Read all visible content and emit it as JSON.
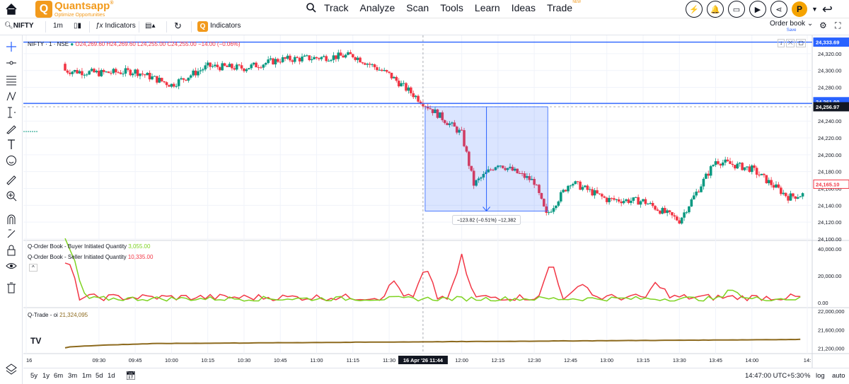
{
  "nav": {
    "brand_name": "Quantsapp",
    "brand_registered": "®",
    "brand_tagline": "Optimize Opportunities",
    "links": [
      "Track",
      "Analyze",
      "Scan",
      "Tools",
      "Learn",
      "Ideas",
      "Trade"
    ],
    "trade_badge": "NEW",
    "avatar_letter": "P"
  },
  "toolbar": {
    "symbol": "NIFTY",
    "interval": "1m",
    "indicators_label": "Indicators",
    "indicators2_label": "Indicators",
    "orderbook_label": "Order book",
    "orderbook_sub": "Save"
  },
  "chart": {
    "main_legend": {
      "symbol": "NIFTY · 1 · NSE",
      "open": "O24,269.60",
      "high": "H24,269.60",
      "low": "L24,255.00",
      "close": "C24,255.00",
      "change": "−14.00 (−0.06%)"
    },
    "price_labels": {
      "top_line": "24,333.69",
      "current": "24,256.97",
      "blue_line": "24,261.00",
      "last": "24,165.10"
    },
    "measure_label": "−123.82 (−0.51%) −12,382",
    "y_ticks": [
      "24,320.00",
      "24,300.00",
      "24,280.00",
      "24,260.00",
      "24,240.00",
      "24,220.00",
      "24,200.00",
      "24,180.00",
      "24,160.00",
      "24,140.00",
      "24,120.00",
      "24,100.00"
    ],
    "indicators": {
      "buyer_label": "Q-Order Book - Buyer Initiated Quantity",
      "buyer_value": "3,055.00",
      "seller_label": "Q-Order Book - Seller Initiated Quantity",
      "seller_value": "10,335.00",
      "ob_ticks": [
        "40,000.00",
        "20,000.00",
        "0.00"
      ],
      "qtrade_label": "Q-Trade - oi",
      "qtrade_value": "21,324,095",
      "qt_ticks": [
        "22,000,000",
        "21,600,000",
        "21,200,000"
      ]
    },
    "x_ticks": [
      "16",
      "09:30",
      "09:45",
      "10:00",
      "10:15",
      "10:30",
      "10:45",
      "11:00",
      "11:15",
      "11:30",
      "12:00",
      "12:15",
      "12:30",
      "12:45",
      "13:00",
      "13:15",
      "13:30",
      "13:45",
      "14:00",
      "14:"
    ],
    "crosshair_date": "16 Apr '26  11:44",
    "colors": {
      "up": "#089981",
      "down": "#f23645",
      "buyer": "#7ed321",
      "seller": "#f23645",
      "qtrade": "#8d6a1e",
      "line": "#2962ff"
    }
  },
  "bottom": {
    "ranges": [
      "5y",
      "1y",
      "6m",
      "3m",
      "1m",
      "5d",
      "1d"
    ],
    "clock": "14:47:00 UTC+5:30",
    "percent_label": "%",
    "log_label": "log",
    "auto_label": "auto"
  },
  "chart_data": {
    "type": "candlestick",
    "xlabel": "",
    "ylabel": "",
    "ylim": [
      24100,
      24335
    ],
    "x_range": [
      "09:15",
      "14:47"
    ],
    "series_points": [
      {
        "time": "09:16",
        "price": 24300
      },
      {
        "time": "09:30",
        "price": 24297
      },
      {
        "time": "09:45",
        "price": 24299
      },
      {
        "time": "10:00",
        "price": 24283
      },
      {
        "time": "10:15",
        "price": 24305
      },
      {
        "time": "10:30",
        "price": 24303
      },
      {
        "time": "10:45",
        "price": 24313
      },
      {
        "time": "11:00",
        "price": 24315
      },
      {
        "time": "11:15",
        "price": 24318
      },
      {
        "time": "11:30",
        "price": 24295
      },
      {
        "time": "11:44",
        "price": 24262
      },
      {
        "time": "12:00",
        "price": 24225
      },
      {
        "time": "12:05",
        "price": 24165
      },
      {
        "time": "12:15",
        "price": 24190
      },
      {
        "time": "12:30",
        "price": 24168
      },
      {
        "time": "12:35",
        "price": 24128
      },
      {
        "time": "12:45",
        "price": 24168
      },
      {
        "time": "13:00",
        "price": 24147
      },
      {
        "time": "13:15",
        "price": 24145
      },
      {
        "time": "13:30",
        "price": 24122
      },
      {
        "time": "13:45",
        "price": 24193
      },
      {
        "time": "14:00",
        "price": 24183
      },
      {
        "time": "14:15",
        "price": 24150
      },
      {
        "time": "14:47",
        "price": 24165
      }
    ],
    "measure": {
      "from_price": 24256.97,
      "to_price": 24133.15,
      "change": -123.82,
      "change_pct": -0.51
    }
  }
}
